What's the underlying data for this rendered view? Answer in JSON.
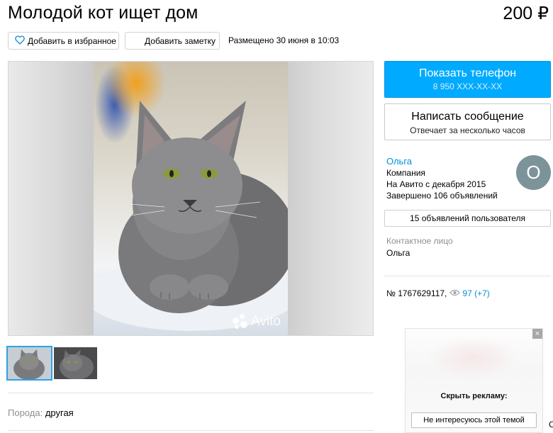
{
  "title": "Молодой кот ищет дом",
  "price": "200 ₽",
  "actions": {
    "favorite_label": "Добавить в избранное",
    "note_label": "Добавить заметку",
    "posted": "Размещено 30 июня в 10:03"
  },
  "gallery": {
    "watermark": "Avito",
    "thumbnail_count": 2,
    "active_thumbnail": 1
  },
  "params": {
    "breed_label": "Порода:",
    "breed_value": "другая"
  },
  "contact": {
    "phone_label": "Показать телефон",
    "phone_masked": "8 950 XXX-XX-XX",
    "message_label": "Написать сообщение",
    "message_sub": "Отвечает за несколько часов"
  },
  "seller": {
    "name": "Ольга",
    "type": "Компания",
    "since": "На Авито с декабря 2015",
    "completed": "Завершено 106 объявлений",
    "avatar_letter": "О",
    "user_ads_label": "15 объявлений пользователя",
    "contact_person_label": "Контактное лицо",
    "contact_person": "Ольга"
  },
  "ad_meta": {
    "number": "№ 1767629117,",
    "views": "97 (+7)"
  },
  "ad_block": {
    "hide_question": "Скрыть рекламу:",
    "hide_option": "Не интересуюсь этой темой",
    "close_symbol": "×",
    "edge_char": "С"
  },
  "colors": {
    "accent": "#00aaff",
    "link": "#0091d9",
    "avatar": "#7d939a"
  }
}
